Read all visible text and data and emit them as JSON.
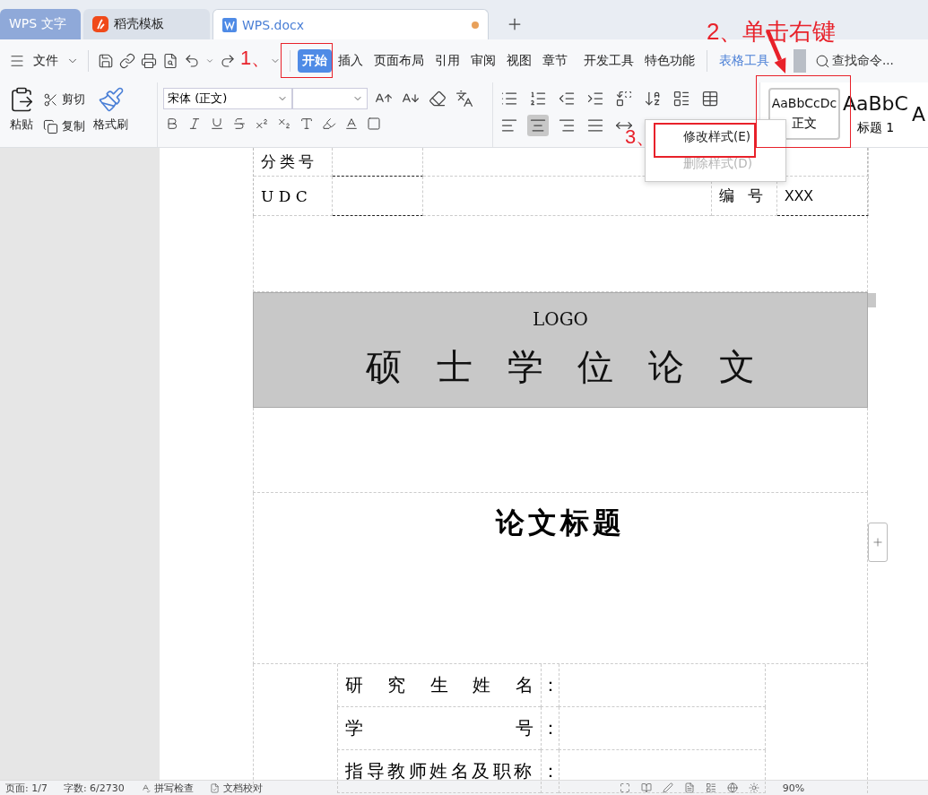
{
  "tabs": [
    {
      "label": "WPS 文字",
      "kind": "app",
      "selected": false
    },
    {
      "label": "稻壳模板",
      "kind": "template",
      "selected": false
    },
    {
      "label": "WPS.docx",
      "kind": "doc",
      "selected": true,
      "unsaved": true
    }
  ],
  "menu": {
    "file": "文件",
    "items": [
      {
        "label": "开始",
        "selected": true
      },
      {
        "label": "插入",
        "selected": false
      },
      {
        "label": "页面布局",
        "selected": false
      },
      {
        "label": "引用",
        "selected": false
      },
      {
        "label": "审阅",
        "selected": false
      },
      {
        "label": "视图",
        "selected": false
      },
      {
        "label": "章节",
        "selected": false
      },
      {
        "label": "开发工具",
        "selected": false
      },
      {
        "label": "特色功能",
        "selected": false
      }
    ],
    "context_tab": "表格工具",
    "search": {
      "placeholder": "查找命令..."
    }
  },
  "ribbon": {
    "paste": "粘贴",
    "cut": "剪切",
    "copy": "复制",
    "format_painter": "格式刷",
    "font": {
      "value": "宋体 (正文)"
    },
    "alignment": [
      {
        "kind": "left",
        "selected": false
      },
      {
        "kind": "center",
        "selected": true
      },
      {
        "kind": "right",
        "selected": false
      },
      {
        "kind": "justify",
        "selected": false
      },
      {
        "kind": "distributed",
        "selected": false
      }
    ],
    "styles": [
      {
        "preview": "AaBbCcDc",
        "name": "正文",
        "selected": true
      },
      {
        "preview": "AaBbC",
        "name": "标题 1",
        "selected": false
      },
      {
        "preview": "A",
        "selected": false
      }
    ]
  },
  "context_menu": {
    "items": [
      {
        "label": "修改样式(E)",
        "disabled": false
      },
      {
        "label": "删除样式(D)",
        "disabled": true
      }
    ]
  },
  "annotations": [
    {
      "label": "1、"
    },
    {
      "label": "2、单击右键"
    },
    {
      "label": "3、"
    }
  ],
  "document": {
    "header_rows": [
      {
        "label": "分类号"
      },
      {
        "label": "U D C",
        "value_label": "编 号",
        "value": "XXX"
      }
    ],
    "logo": "LOGO",
    "degree": "硕 士 学 位 论 文",
    "thesis_title": "论文标题",
    "info_rows": [
      {
        "label": "研 究 生 姓 名",
        "colon": "："
      },
      {
        "label": "学 号",
        "colon": "："
      },
      {
        "label": "指导教师姓名及职称",
        "colon": "："
      }
    ]
  },
  "status_bar": [
    {
      "label": "页面: 1/7"
    },
    {
      "label": "字数: 6/2730"
    },
    {
      "label": "拼写检查"
    },
    {
      "label": "文档校对"
    },
    {
      "label": "90%"
    }
  ]
}
